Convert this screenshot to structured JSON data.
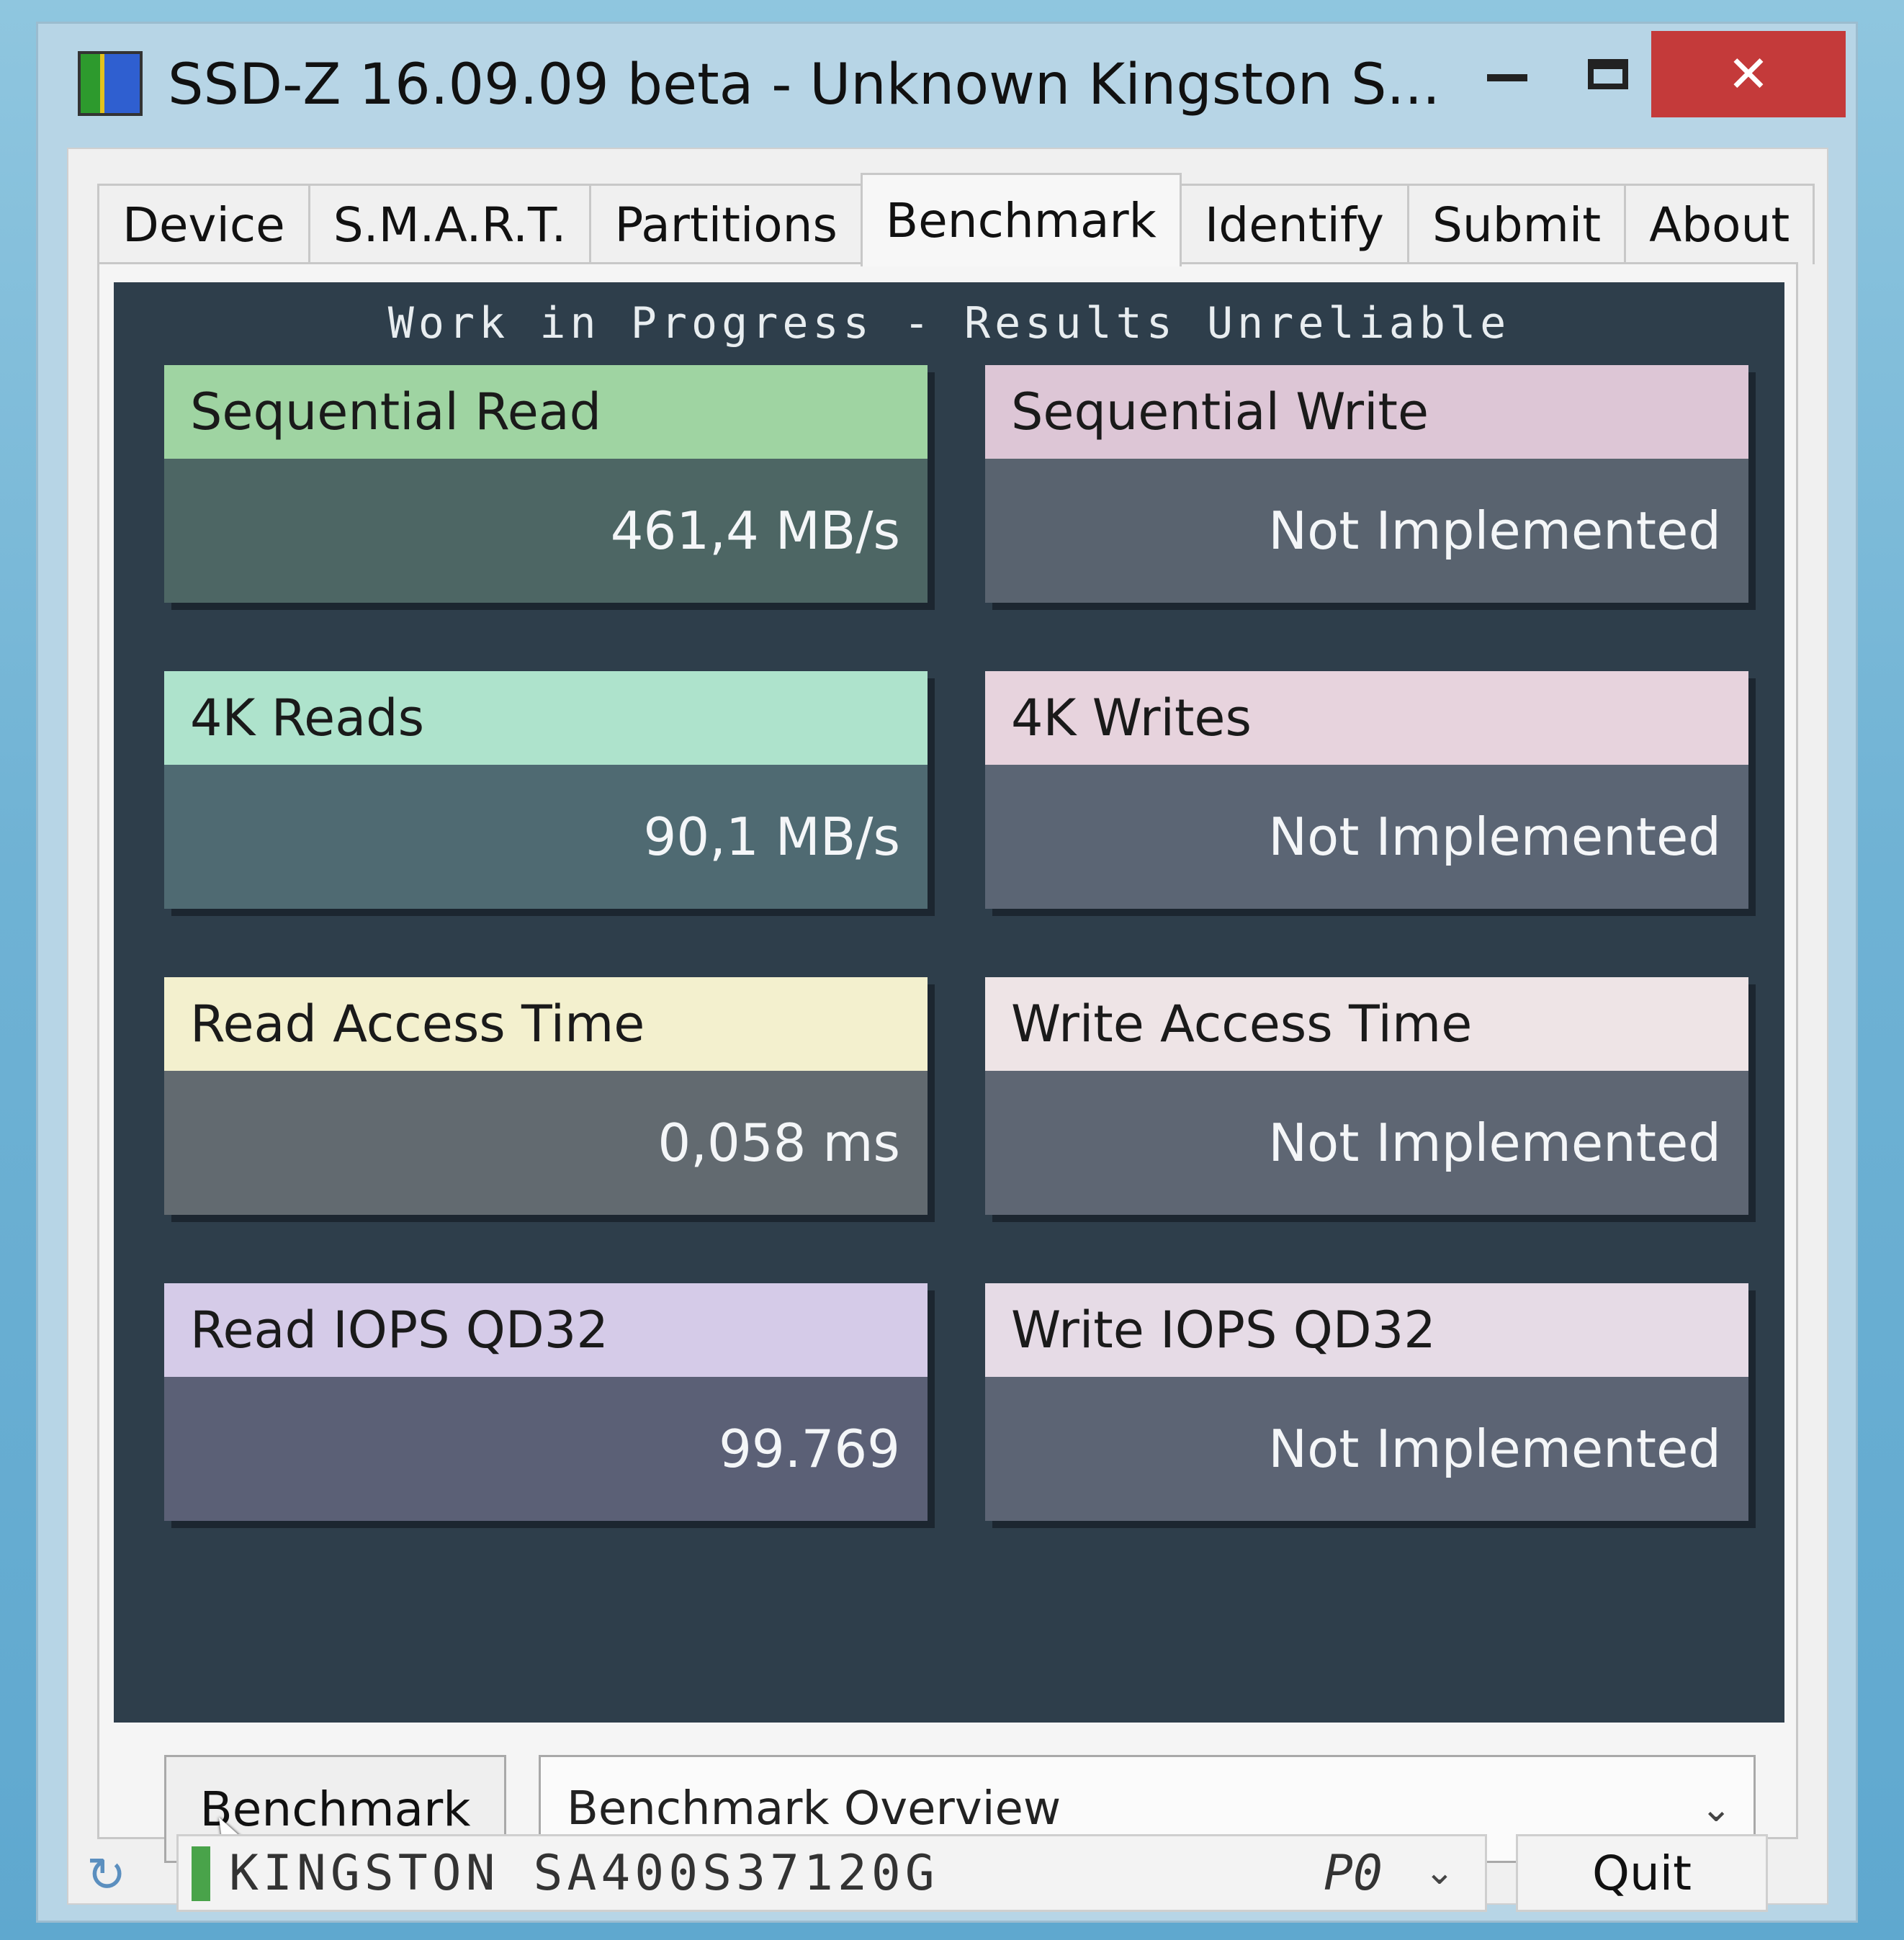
{
  "window": {
    "title": "SSD-Z 16.09.09 beta - Unknown Kingston S...",
    "controls": {
      "minimize": "",
      "maximize": "",
      "close": "✕"
    }
  },
  "tabs": [
    {
      "label": "Device"
    },
    {
      "label": "S.M.A.R.T."
    },
    {
      "label": "Partitions"
    },
    {
      "label": "Benchmark",
      "active": true
    },
    {
      "label": "Identify"
    },
    {
      "label": "Submit"
    },
    {
      "label": "About"
    }
  ],
  "benchmark": {
    "notice": "Work in Progress - Results Unreliable",
    "cards": [
      {
        "title": "Sequential Read",
        "value": "461,4 MB/s",
        "head_color": "#9fd4a2",
        "body_color": "#4d6664"
      },
      {
        "title": "Sequential Write",
        "value": "Not Implemented",
        "head_color": "#ddc6d6",
        "body_color": "#59636f"
      },
      {
        "title": "4K Reads",
        "value": "90,1 MB/s",
        "head_color": "#aee3cc",
        "body_color": "#4f6a72"
      },
      {
        "title": "4K Writes",
        "value": "Not Implemented",
        "head_color": "#e7d3dd",
        "body_color": "#5b6574"
      },
      {
        "title": "Read Access Time",
        "value": "0,058 ms",
        "head_color": "#f3f0ce",
        "body_color": "#626a70"
      },
      {
        "title": "Write Access Time",
        "value": "Not Implemented",
        "head_color": "#eee4e6",
        "body_color": "#5e6673"
      },
      {
        "title": "Read IOPS QD32",
        "value": "99.769",
        "head_color": "#d5cbe8",
        "body_color": "#5b6076"
      },
      {
        "title": "Write IOPS QD32",
        "value": "Not Implemented",
        "head_color": "#e6dbe6",
        "body_color": "#5c6474"
      }
    ],
    "run_button": "Benchmark",
    "mode_select": {
      "selected": "Benchmark Overview",
      "arrow": "⌄"
    }
  },
  "statusbar": {
    "refresh_icon": "↻",
    "drive_name": "KINGSTON SA400S37120G",
    "port": "P0",
    "port_arrow": "⌄",
    "quit_label": "Quit"
  },
  "colors": {
    "panel_bg": "#2e3e4b",
    "close_button": "#c43a3a",
    "drive_led": "#49a34a"
  }
}
